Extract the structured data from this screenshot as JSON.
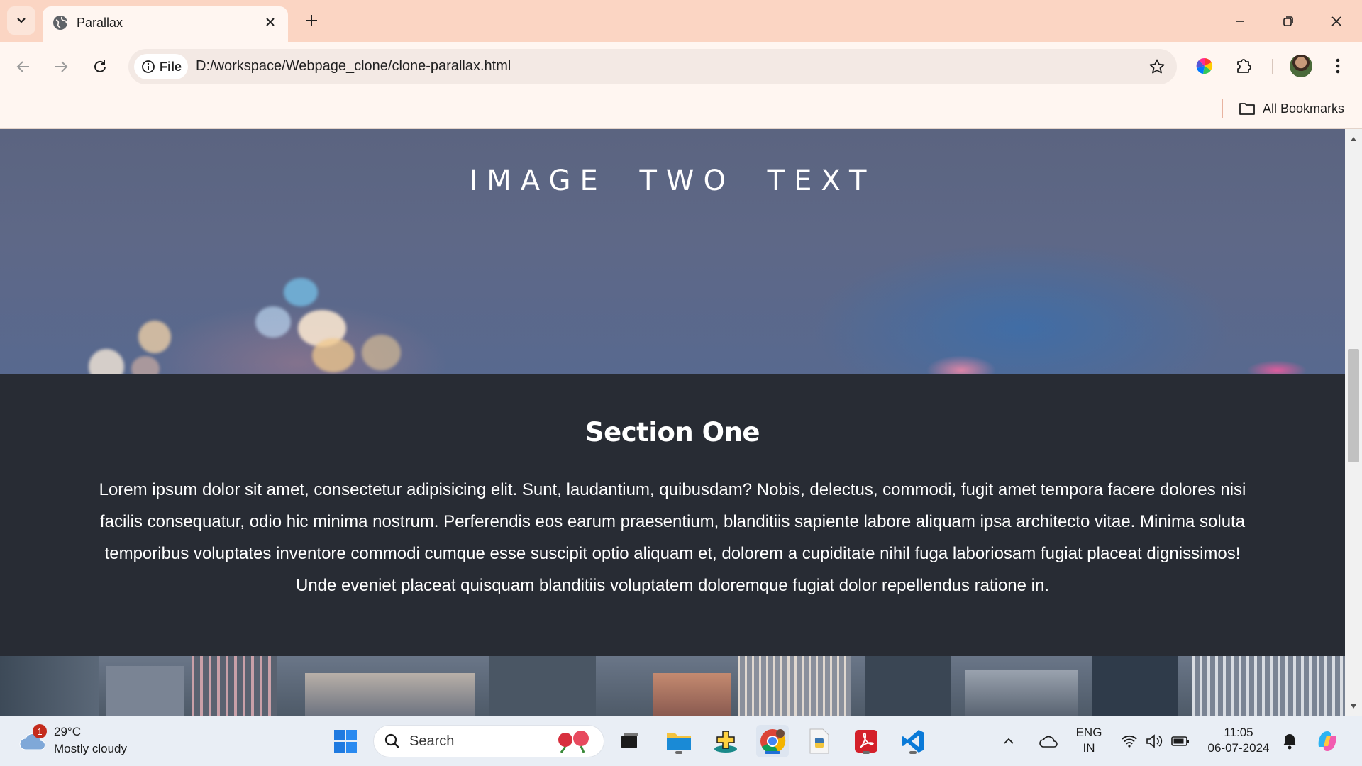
{
  "browser": {
    "tab": {
      "title": "Parallax"
    },
    "address": {
      "chip_label": "File",
      "url": "D:/workspace/Webpage_clone/clone-parallax.html"
    },
    "bookmarks": {
      "all_label": "All Bookmarks"
    }
  },
  "page": {
    "hero_two_title": "IMAGE TWO TEXT",
    "section_one": {
      "heading": "Section One",
      "body": "Lorem ipsum dolor sit amet, consectetur adipisicing elit. Sunt, laudantium, quibusdam? Nobis, delectus, commodi, fugit amet tempora facere dolores nisi facilis consequatur, odio hic minima nostrum. Perferendis eos earum praesentium, blanditiis sapiente labore aliquam ipsa architecto vitae. Minima soluta temporibus voluptates inventore commodi cumque esse suscipit optio aliquam et, dolorem a cupiditate nihil fuga laboriosam fugiat placeat dignissimos! Unde eveniet placeat quisquam blanditiis voluptatem doloremque fugiat dolor repellendus ratione in."
    }
  },
  "taskbar": {
    "weather": {
      "badge": "1",
      "temp": "29°C",
      "condition": "Mostly cloudy"
    },
    "search_label": "Search",
    "language": {
      "line1": "ENG",
      "line2": "IN"
    },
    "clock": {
      "time": "11:05",
      "date": "06-07-2024"
    }
  },
  "colors": {
    "tabbar_bg": "#fbd5c3",
    "toolbar_bg": "#fff6f1",
    "section_bg": "#282c34",
    "taskbar_bg": "#e9eef5"
  }
}
